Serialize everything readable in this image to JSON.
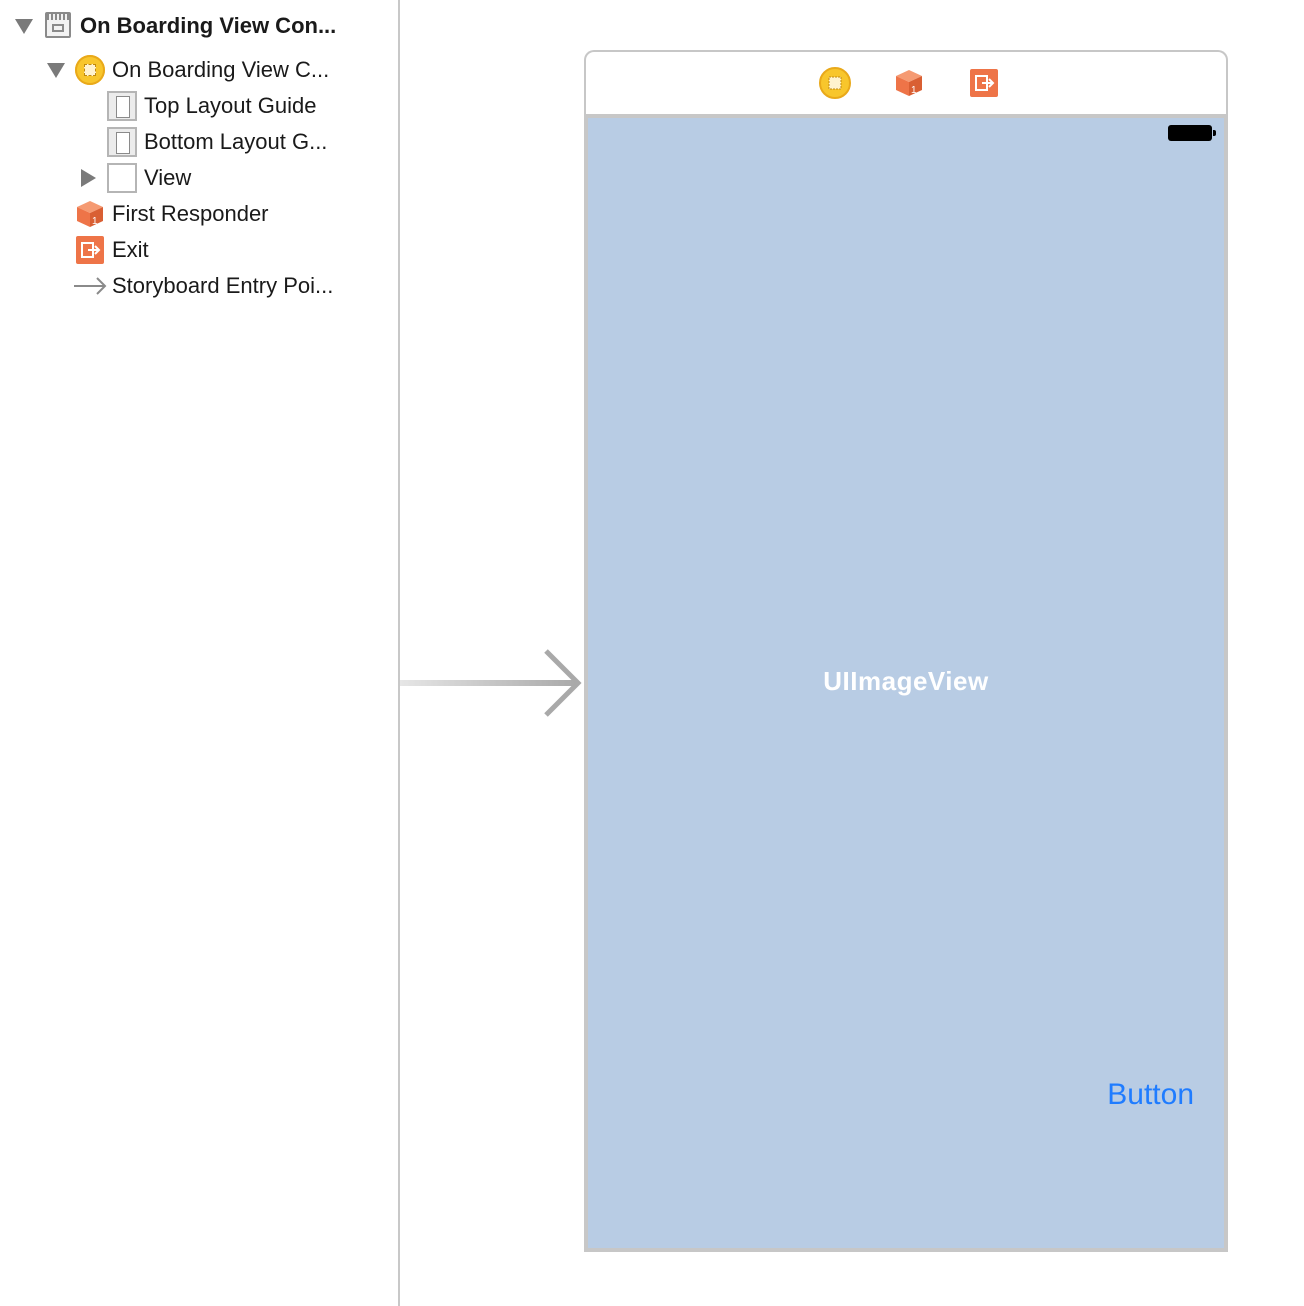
{
  "outline": {
    "scene_title": "On Boarding View Con...",
    "items": [
      {
        "label": "On Boarding View C..."
      },
      {
        "label": "Top Layout Guide"
      },
      {
        "label": "Bottom Layout G..."
      },
      {
        "label": "View"
      },
      {
        "label": "First Responder"
      },
      {
        "label": "Exit"
      },
      {
        "label": "Storyboard Entry Poi..."
      }
    ]
  },
  "canvas": {
    "dock_icons": [
      "view-controller-icon",
      "first-responder-icon",
      "exit-icon"
    ],
    "image_view_label": "UIImageView",
    "button_label": "Button",
    "view_background": "#b8cce4",
    "button_color": "#1f7cff"
  },
  "colors": {
    "view_controller": "#f8c62c",
    "first_responder": "#ee7448",
    "exit": "#ee7448"
  }
}
